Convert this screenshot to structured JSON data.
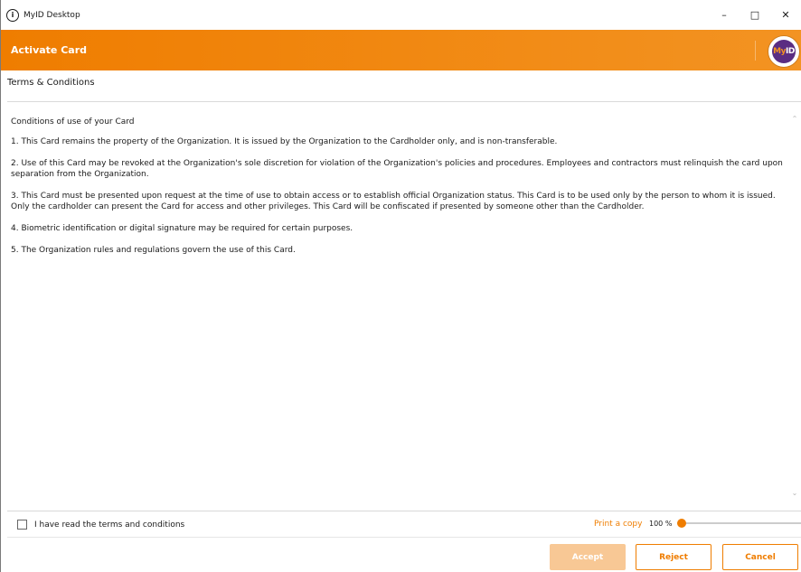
{
  "window": {
    "title": "MyID Desktop",
    "info_icon": "i",
    "controls": {
      "minimize": "–",
      "maximize": "□",
      "close": "✕"
    }
  },
  "header": {
    "title": "Activate Card",
    "logo_prefix": "My",
    "logo_suffix": "ID"
  },
  "section": {
    "title": "Terms & Conditions"
  },
  "terms": {
    "heading": "Conditions of use of your Card",
    "items": [
      "1. This Card remains the property of the Organization. It is issued by the Organization to the Cardholder only, and is non-transferable.",
      "2. Use of this Card may be revoked at the Organization's sole discretion for violation of the Organization's policies and procedures. Employees and contractors must relinquish the card upon separation from the Organization.",
      "3. This Card must be presented upon request at the time of use to obtain access or to establish official Organization status. This Card is to be used only by the person to whom it is issued. Only the cardholder can present the Card for access and other privileges. This Card will be confiscated if presented by someone other than the Cardholder.",
      "4. Biometric identification or digital signature may be required for certain purposes.",
      "5. The Organization rules and regulations govern the use of this Card."
    ]
  },
  "footer": {
    "agree_label": "I have read the terms and conditions",
    "agree_checked": false,
    "print_label": "Print a copy",
    "zoom_label": "100 %",
    "zoom_percent": 100
  },
  "buttons": {
    "accept": "Accept",
    "reject": "Reject",
    "cancel": "Cancel"
  },
  "colors": {
    "accent": "#ef7d00",
    "accent_disabled": "#f8c895"
  },
  "icons": {
    "info": "info-icon",
    "scroll_up": "chevron-up-icon",
    "scroll_down": "chevron-down-icon",
    "logo": "myid-logo"
  }
}
